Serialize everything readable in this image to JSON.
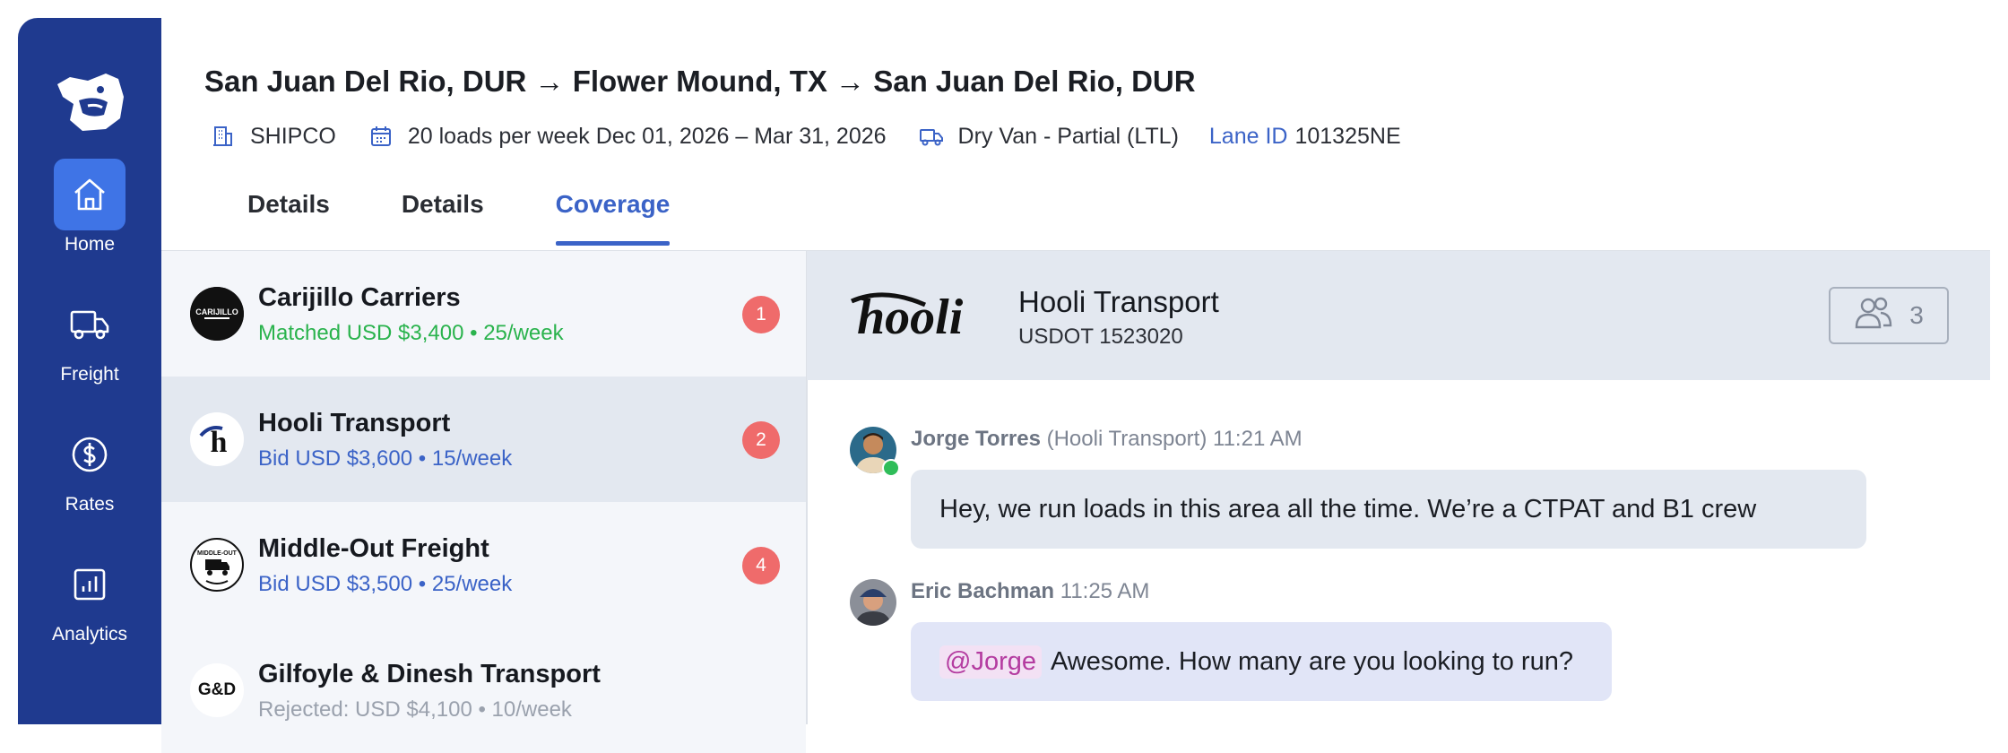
{
  "sidebar": {
    "items": [
      {
        "label": "Home",
        "icon": "home-icon",
        "active": true
      },
      {
        "label": "Freight",
        "icon": "truck-icon",
        "active": false
      },
      {
        "label": "Rates",
        "icon": "dollar-icon",
        "active": false
      },
      {
        "label": "Analytics",
        "icon": "analytics-icon",
        "active": false
      }
    ]
  },
  "header": {
    "title": "San Juan Del Rio, DUR → Flower Mound, TX → San Juan Del Rio, DUR",
    "shipper": "SHIPCO",
    "schedule": "20 loads per week Dec 01, 2026 – Mar 31, 2026",
    "equipment": "Dry Van - Partial (LTL)",
    "lane_id_label": "Lane ID",
    "lane_id": "101325NE"
  },
  "tabs": [
    {
      "label": "Details",
      "active": false
    },
    {
      "label": "Details",
      "active": false
    },
    {
      "label": "Coverage",
      "active": true
    }
  ],
  "carriers": [
    {
      "name": "Carijillo Carriers",
      "status": "Matched USD $3,400 • 25/week",
      "status_type": "matched",
      "badge": "1",
      "logo_text": "CARIJILLO"
    },
    {
      "name": "Hooli Transport",
      "status": "Bid USD $3,600 • 15/week",
      "status_type": "bid",
      "badge": "2",
      "logo_text": "h",
      "selected": true
    },
    {
      "name": "Middle-Out Freight",
      "status": "Bid USD $3,500 • 25/week",
      "status_type": "bid",
      "badge": "4",
      "logo_text": "MIDDLE-OUT"
    },
    {
      "name": "Gilfoyle & Dinesh Transport",
      "status": "Rejected: USD $4,100 • 10/week",
      "status_type": "rejected",
      "logo_text": "G&D"
    }
  ],
  "chat": {
    "logo_text": "hooli",
    "carrier_name": "Hooli Transport",
    "usdot": "USDOT 1523020",
    "member_count": "3",
    "messages": [
      {
        "author": "Jorge Torres",
        "company": "(Hooli Transport)",
        "time": "11:21 AM",
        "text": "Hey, we run loads in this area all the time. We’re a CTPAT and B1 crew"
      },
      {
        "author": "Eric Bachman",
        "time": "11:25 AM",
        "mention": "@Jorge",
        "text": "Awesome. How many are you looking to run?"
      }
    ]
  },
  "colors": {
    "sidebar": "#1f3a8f",
    "accent": "#3b63c7",
    "matched": "#2ab34d",
    "badge": "#ef6b6b"
  }
}
